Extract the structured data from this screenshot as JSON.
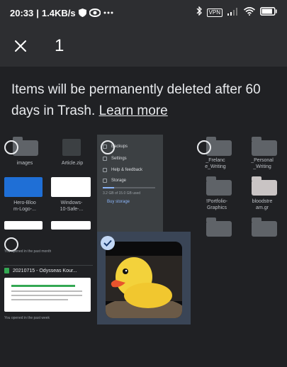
{
  "status_bar": {
    "time": "20:33",
    "network_speed": "1.4KB/s",
    "vpn_label": "VPN",
    "battery_level": 0.85,
    "icons": [
      "shield-icon",
      "eye-icon",
      "more-icon",
      "bluetooth-icon",
      "vpn-icon",
      "signal-icon",
      "wifi-icon",
      "battery-icon"
    ]
  },
  "selection_bar": {
    "close_icon": "close-icon",
    "selected_count": "1"
  },
  "notice": {
    "text": "Items will be permanently deleted after 60 days in Trash. ",
    "link_label": "Learn more"
  },
  "grid": {
    "row1": [
      {
        "label": "images"
      },
      {
        "label": "Article.zip"
      },
      {
        "label": "_Frelanc\ne_Writing"
      },
      {
        "label": "_Personal\n_Writing"
      }
    ],
    "row2": [
      {
        "label": "Hero-Bloo\nm-Logo-..."
      },
      {
        "label": "Windows-\n10-Safe-..."
      },
      {
        "label": "!Portfolio-\nGraphics"
      },
      {
        "label": "bloodstre\nam.gr"
      }
    ],
    "opened_past_month": "You opened in the past month",
    "file_title": "20210715 - Odysseas Kour...",
    "opened_past_week": "You opened in the past week"
  },
  "drawer": {
    "items": [
      "Backups",
      "Settings",
      "Help & feedback",
      "Storage"
    ],
    "storage_used": "3.2 GB of 15.0 GB used",
    "storage_fraction": 0.21,
    "buy_storage": "Buy storage"
  },
  "colors": {
    "background": "#202124",
    "toolbar": "#2d2e31",
    "selection_highlight": "#3a4556",
    "accent": "#8ab4f8"
  }
}
